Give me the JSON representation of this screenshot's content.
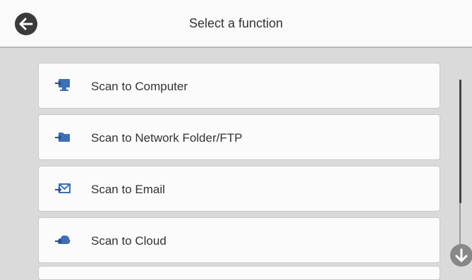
{
  "header": {
    "title": "Select a function"
  },
  "items": [
    {
      "label": "Scan to Computer",
      "icon": "computer-icon"
    },
    {
      "label": "Scan to Network Folder/FTP",
      "icon": "folder-icon"
    },
    {
      "label": "Scan to Email",
      "icon": "email-icon"
    },
    {
      "label": "Scan to Cloud",
      "icon": "cloud-icon"
    }
  ],
  "colors": {
    "icon_blue": "#3d6fb4",
    "header_bg": "#fafafa",
    "list_bg": "#dadada"
  }
}
